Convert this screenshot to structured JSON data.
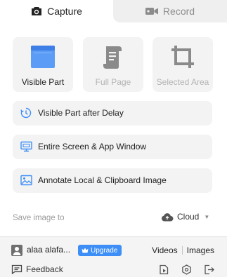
{
  "tabs": {
    "capture": {
      "label": "Capture",
      "icon": "camera-icon"
    },
    "record": {
      "label": "Record",
      "icon": "video-icon"
    }
  },
  "tiles": {
    "visible": {
      "label": "Visible Part",
      "icon": "browser-window-icon"
    },
    "full": {
      "label": "Full Page",
      "icon": "scroll-page-icon"
    },
    "area": {
      "label": "Selected Area",
      "icon": "crop-icon"
    }
  },
  "rows": {
    "delay": {
      "label": "Visible Part after Delay",
      "icon": "timer-icon"
    },
    "screen": {
      "label": "Entire Screen & App Window",
      "icon": "monitor-icon"
    },
    "annotate": {
      "label": "Annotate Local & Clipboard Image",
      "icon": "image-icon"
    }
  },
  "save": {
    "label": "Save image to",
    "value": "Cloud",
    "icon": "cloud-upload-icon"
  },
  "footer": {
    "user_name": "alaa alafa...",
    "upgrade_label": "Upgrade",
    "videos_label": "Videos",
    "images_label": "Images",
    "feedback_label": "Feedback"
  },
  "colors": {
    "accent": "#3d8ef7",
    "tile_bg": "#f3f3f3",
    "disabled_text": "#b4b4b4",
    "disabled_icon": "#8a8a8a"
  }
}
